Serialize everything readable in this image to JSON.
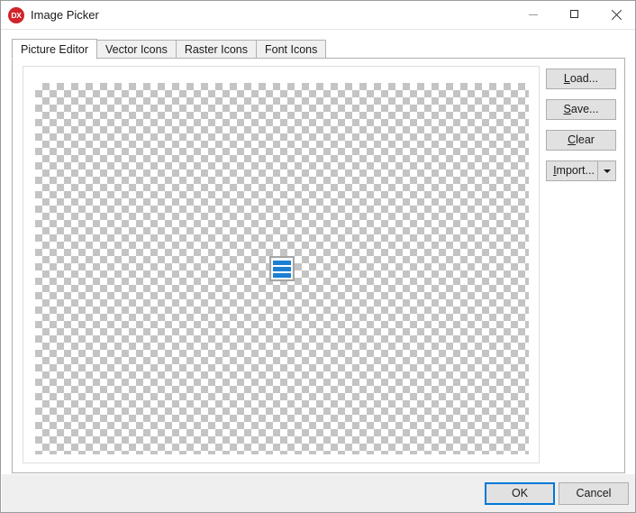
{
  "window": {
    "title": "Image Picker",
    "logo_text": "DX",
    "logo_color": "#d0232b",
    "controls": {
      "minimize": {
        "name": "minimize",
        "glyph": "minimize-icon"
      },
      "maximize": {
        "name": "maximize",
        "glyph": "maximize-icon"
      },
      "close": {
        "name": "close",
        "glyph": "close-icon"
      }
    }
  },
  "tabs": [
    {
      "label": "Picture Editor",
      "active": true
    },
    {
      "label": "Vector Icons",
      "active": false
    },
    {
      "label": "Raster Icons",
      "active": false
    },
    {
      "label": "Font Icons",
      "active": false
    }
  ],
  "picture_editor": {
    "canvas": {
      "background": "checkerboard-transparency",
      "checker_colors": [
        "#ffffff",
        "#c4c4c4"
      ],
      "checker_size_px": 8
    },
    "selected_image": {
      "name": "list-bars-icon",
      "accent_color": "#1b7fd4",
      "selected": true
    },
    "side_buttons": [
      {
        "label": "Load...",
        "mnemonic": "L",
        "before": "",
        "after": "oad..."
      },
      {
        "label": "Save...",
        "mnemonic": "S",
        "before": "",
        "after": "ave..."
      },
      {
        "label": "Clear",
        "mnemonic": "C",
        "before": "",
        "after": "lear"
      },
      {
        "label": "Import...",
        "mnemonic": "I",
        "before": "",
        "after": "mport..."
      }
    ],
    "import_button": {
      "label": "Import...",
      "mnemonic": "I",
      "rest": "mport...",
      "has_dropdown": true
    }
  },
  "footer": {
    "ok_label": "OK",
    "cancel_label": "Cancel",
    "default_button": "OK",
    "focus_color": "#0078d7"
  }
}
